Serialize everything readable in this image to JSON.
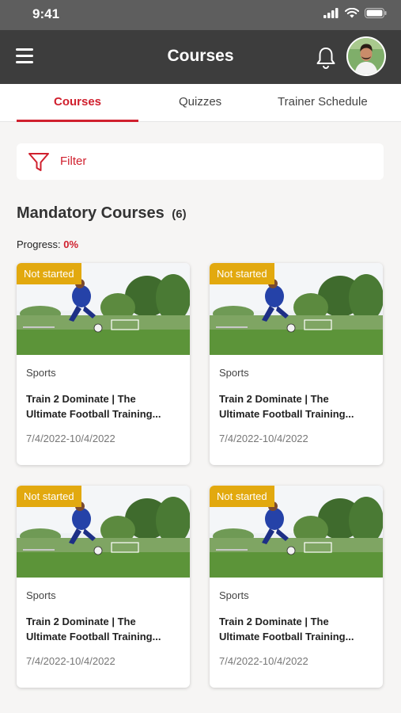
{
  "status_bar": {
    "time": "9:41"
  },
  "header": {
    "title": "Courses"
  },
  "tabs": [
    {
      "label": "Courses",
      "active": true
    },
    {
      "label": "Quizzes",
      "active": false
    },
    {
      "label": "Trainer Schedule",
      "active": false
    }
  ],
  "filter": {
    "label": "Filter"
  },
  "section": {
    "title": "Mandatory Courses",
    "count": "(6)",
    "progress_label": "Progress:",
    "progress_value": "0%"
  },
  "courses": [
    {
      "status": "Not started",
      "category": "Sports",
      "title_line1": "Train 2 Dominate | The",
      "title_line2": "Ultimate Football Training...",
      "dates": "7/4/2022-10/4/2022"
    },
    {
      "status": "Not started",
      "category": "Sports",
      "title_line1": "Train 2 Dominate | The",
      "title_line2": "Ultimate Football Training...",
      "dates": "7/4/2022-10/4/2022"
    },
    {
      "status": "Not started",
      "category": "Sports",
      "title_line1": "Train 2 Dominate | The",
      "title_line2": "Ultimate Football Training...",
      "dates": "7/4/2022-10/4/2022"
    },
    {
      "status": "Not started",
      "category": "Sports",
      "title_line1": "Train 2 Dominate | The",
      "title_line2": "Ultimate Football Training...",
      "dates": "7/4/2022-10/4/2022"
    }
  ],
  "colors": {
    "accent": "#d0202e",
    "badge": "#e2a90f",
    "app_bar": "#3d3d3d"
  },
  "icons": [
    "menu-icon",
    "bell-icon",
    "filter-icon",
    "signal-icon",
    "wifi-icon",
    "battery-icon"
  ]
}
